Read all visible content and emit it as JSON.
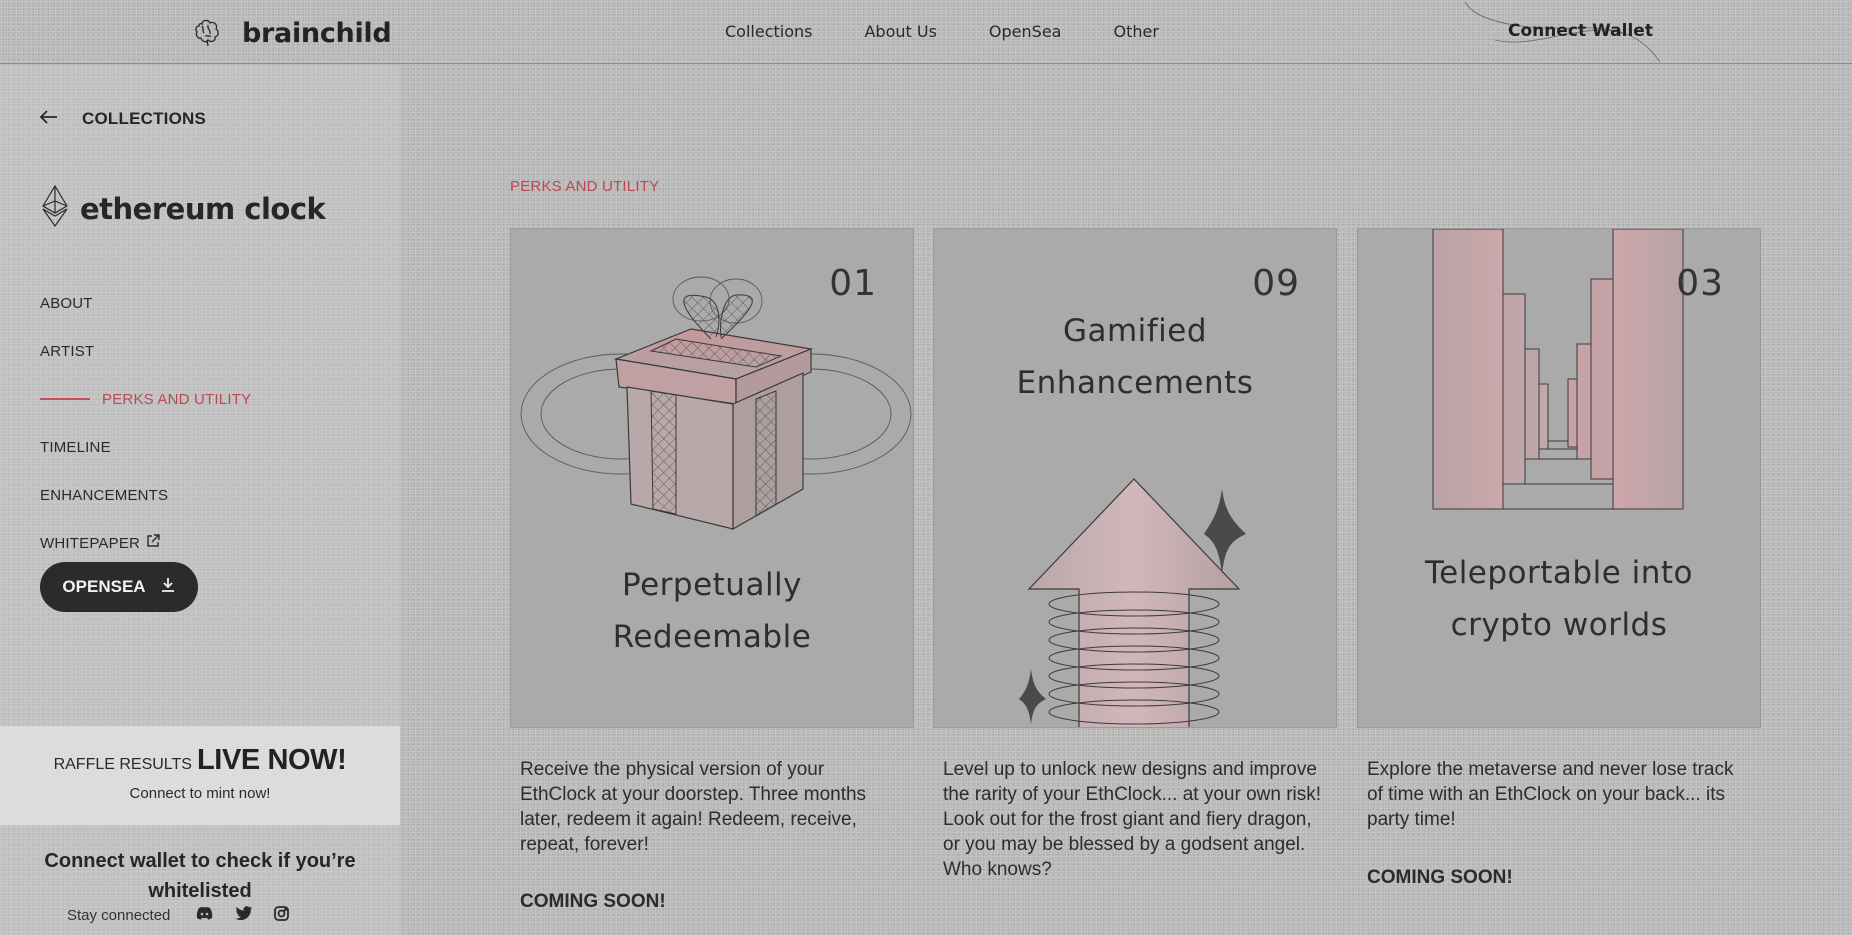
{
  "brand": {
    "name": "brainchild",
    "logo_icon": "brain-icon"
  },
  "nav": {
    "items": [
      "Collections",
      "About Us",
      "OpenSea",
      "Other"
    ],
    "connect_label": "Connect Wallet"
  },
  "sidebar": {
    "back_label": "COLLECTIONS",
    "collection_name": "ethereum clock",
    "menu": [
      {
        "label": "ABOUT"
      },
      {
        "label": "ARTIST"
      },
      {
        "label": "PERKS AND UTILITY",
        "active": true
      },
      {
        "label": "TIMELINE"
      },
      {
        "label": "ENHANCEMENTS"
      },
      {
        "label": "WHITEPAPER"
      }
    ],
    "opensea_label": "OPENSEA",
    "raffle": {
      "prefix": "RAFFLE RESULTS",
      "headline": "LIVE NOW!",
      "sub": "Connect to mint now!"
    },
    "whitelist_text": "Connect wallet to check if you’re whitelisted",
    "stay_connected": "Stay connected",
    "social_icons": [
      "discord-icon",
      "twitter-icon",
      "instagram-icon"
    ]
  },
  "main": {
    "section_label": "PERKS AND UTILITY",
    "cards": [
      {
        "number": "01",
        "title_line1": "Perpetually",
        "title_line2": "Redeemable",
        "description": "Receive the physical version of your EthClock at your doorstep. Three months later, redeem it again! Redeem, receive, repeat, forever!",
        "status": "COMING SOON!"
      },
      {
        "number": "09",
        "title_line1": "Gamified",
        "title_line2": "Enhancements",
        "description": "Level up to unlock new designs and improve the rarity of your EthClock... at your own risk! Look out for the frost giant and fiery dragon, or you may be blessed by a godsent angel. Who knows?",
        "status": ""
      },
      {
        "number": "03",
        "title_line1": "Teleportable into",
        "title_line2": "crypto worlds",
        "description": "Explore the metaverse and never lose track of time with an EthClock on your back... its party time!",
        "status": "COMING SOON!"
      }
    ]
  },
  "colors": {
    "accent": "#c35058",
    "dark_button": "#2b2b2b",
    "pink": "#c9a3a6"
  }
}
